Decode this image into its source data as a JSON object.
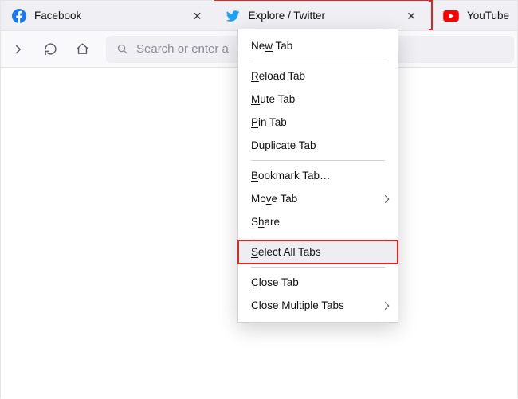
{
  "colors": {
    "highlight": "#e02424"
  },
  "tabs": [
    {
      "label": "Facebook",
      "icon": "facebook"
    },
    {
      "label": "Explore / Twitter",
      "icon": "twitter",
      "active": true,
      "highlighted": true
    },
    {
      "label": "YouTube",
      "icon": "youtube"
    }
  ],
  "urlbar": {
    "placeholder": "Search or enter a"
  },
  "context_menu": {
    "items": [
      {
        "pre": "Ne",
        "accel": "w",
        "post": " Tab"
      },
      {
        "sep": true
      },
      {
        "pre": "",
        "accel": "R",
        "post": "eload Tab"
      },
      {
        "pre": "",
        "accel": "M",
        "post": "ute Tab"
      },
      {
        "pre": "",
        "accel": "P",
        "post": "in Tab"
      },
      {
        "pre": "",
        "accel": "D",
        "post": "uplicate Tab"
      },
      {
        "sep": true
      },
      {
        "pre": "",
        "accel": "B",
        "post": "ookmark Tab…"
      },
      {
        "pre": "Mo",
        "accel": "v",
        "post": "e Tab",
        "has_sub": true
      },
      {
        "pre": "S",
        "accel": "h",
        "post": "are"
      },
      {
        "sep": true
      },
      {
        "pre": "",
        "accel": "S",
        "post": "elect All Tabs",
        "highlighted": true
      },
      {
        "sep": true
      },
      {
        "pre": "",
        "accel": "C",
        "post": "lose Tab"
      },
      {
        "pre": "Close ",
        "accel": "M",
        "post": "ultiple Tabs",
        "has_sub": true
      }
    ]
  }
}
